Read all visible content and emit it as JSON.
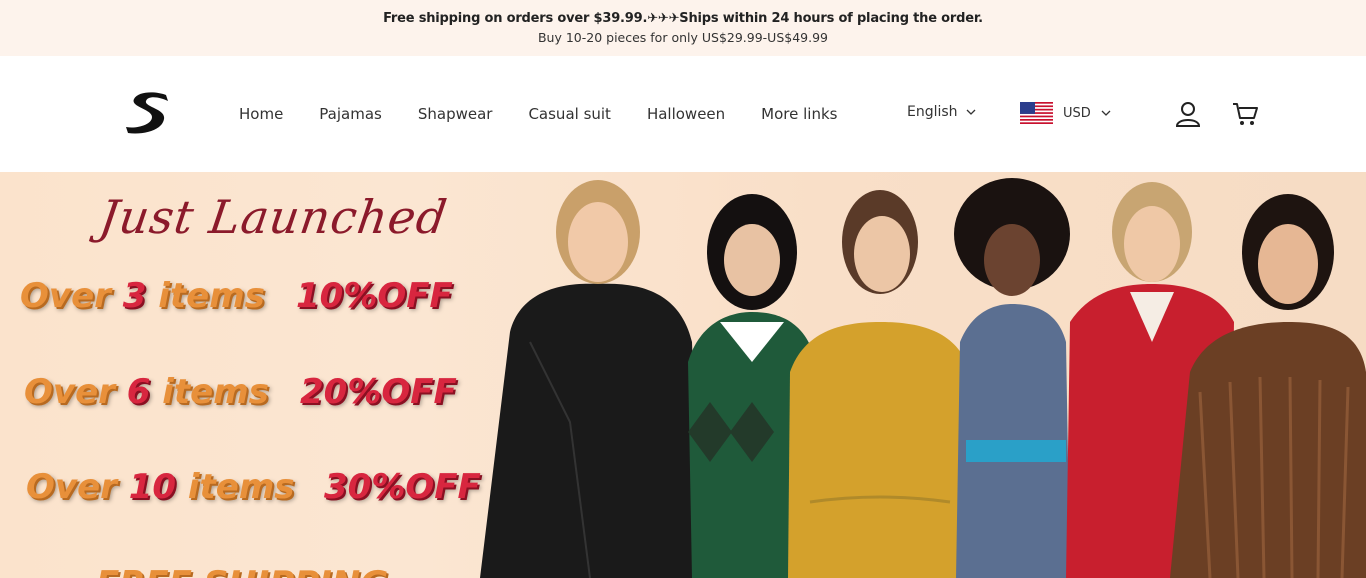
{
  "announcement": {
    "line1": "Free shipping on orders over $39.99.✈✈✈Ships within 24 hours of placing the order.",
    "line2": "Buy 10-20 pieces for only US$29.99-US$49.99"
  },
  "header": {
    "logo_letter": "S",
    "nav": [
      "Home",
      "Pajamas",
      "Shapwear",
      "Casual suit",
      "Halloween",
      "More links"
    ],
    "language": "English",
    "currency": "USD"
  },
  "hero": {
    "script_title": "Just Launched",
    "offers": [
      {
        "prefix": "Over ",
        "num": "3",
        "suffix": " items",
        "discount": "10%OFF"
      },
      {
        "prefix": "Over ",
        "num": "6",
        "suffix": " items",
        "discount": "20%OFF"
      },
      {
        "prefix": "Over ",
        "num": "10",
        "suffix": " items",
        "discount": "30%OFF"
      }
    ],
    "free_shipping": "FREE SHIPPING"
  },
  "colors": {
    "announce_bg": "#fdf3ec",
    "hero_bg": "#fbe3cc",
    "offer_orange": "#e8903a",
    "offer_red": "#d8263f",
    "script_red": "#8b1a2b"
  }
}
